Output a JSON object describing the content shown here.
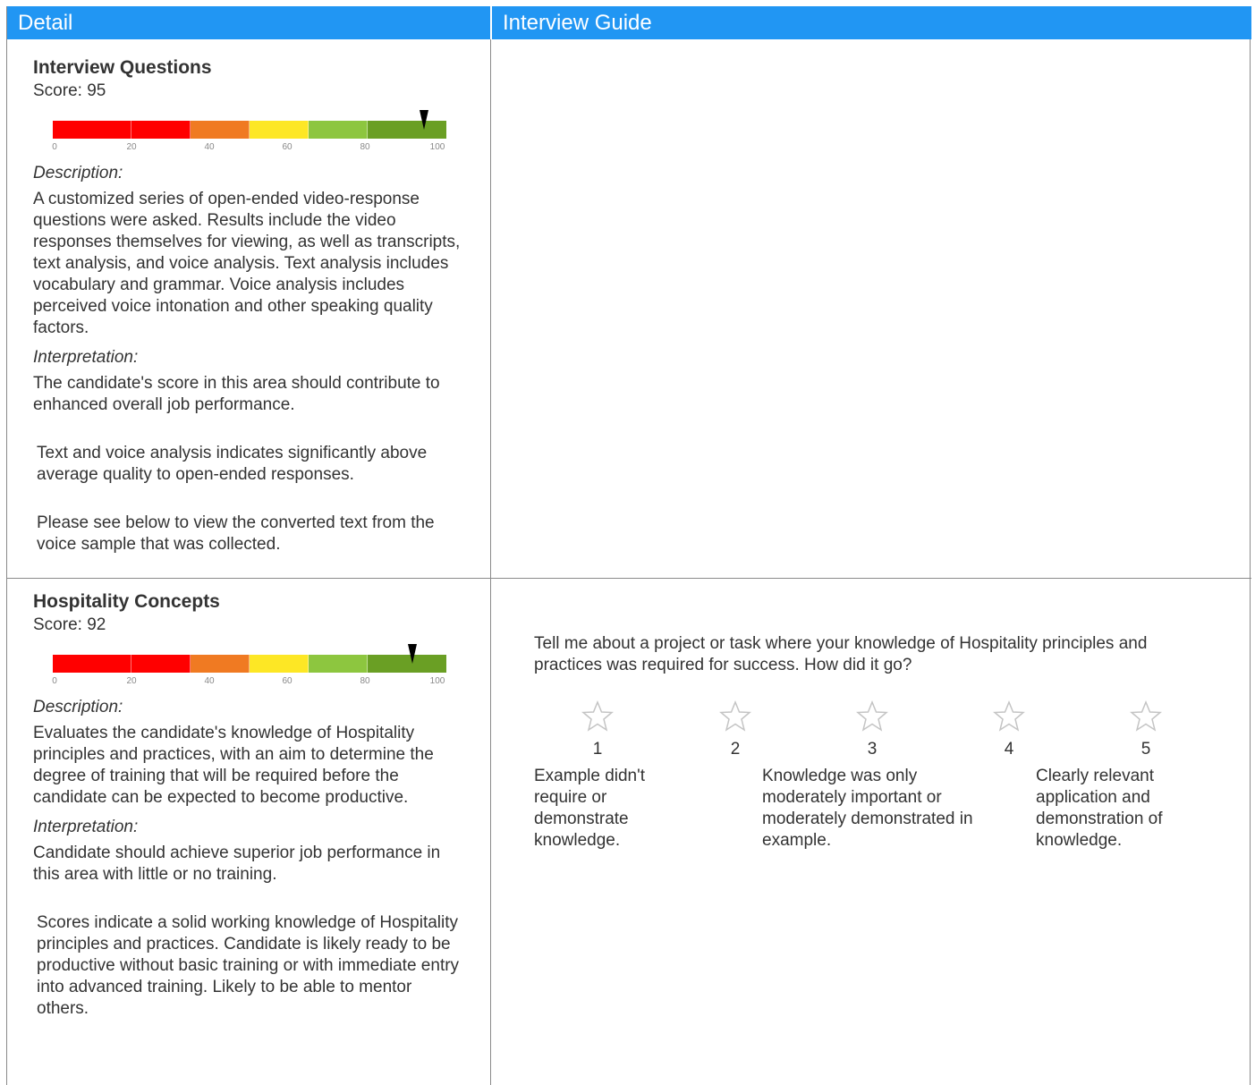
{
  "headers": {
    "detail": "Detail",
    "interview_guide": "Interview Guide"
  },
  "sections": [
    {
      "title": "Interview Questions",
      "score_text": "Score: 95",
      "score": 95,
      "gauge_ticks": [
        "0",
        "20",
        "40",
        "60",
        "80",
        "100"
      ],
      "description_label": "Description:",
      "description": "A customized series of open-ended video-response questions were asked. Results include the video responses themselves for viewing, as well as  transcripts, text analysis, and voice analysis. Text analysis includes vocabulary and grammar. Voice analysis includes perceived voice intonation and other speaking quality factors.",
      "interpretation_label": "Interpretation:",
      "interpretation": "The candidate's score in this area should contribute to enhanced overall job performance.",
      "notes": [
        "Text and voice analysis indicates significantly above average quality to open-ended responses.",
        "Please see below to view the converted text from the voice sample that was collected."
      ]
    },
    {
      "title": "Hospitality Concepts",
      "score_text": "Score: 92",
      "score": 92,
      "gauge_ticks": [
        "0",
        "20",
        "40",
        "60",
        "80",
        "100"
      ],
      "description_label": "Description:",
      "description": "Evaluates the candidate's knowledge of Hospitality principles and practices, with an aim to determine the degree of training that will be required before the candidate can be expected to become productive.",
      "interpretation_label": "Interpretation:",
      "interpretation": "Candidate should achieve superior job performance in this area with little or no training.",
      "notes": [
        "Scores indicate a solid working knowledge of Hospitality principles and practices. Candidate is likely ready to be productive without basic training or with immediate entry into advanced training. Likely to be able to mentor others."
      ]
    }
  ],
  "gauge_colors": [
    "#ff0000",
    "#ff0000",
    "#f07a22",
    "#fde725",
    "#8dc63f",
    "#6a9f24"
  ],
  "guide": {
    "question": "Tell me about a project or task where your knowledge of Hospitality principles and practices was required for success. How did it go?",
    "rating_numbers": [
      "1",
      "2",
      "3",
      "4",
      "5"
    ],
    "anchors": {
      "low": "Example didn't require or demonstrate knowledge.",
      "mid": "Knowledge was only moderately important or moderately demonstrated in example.",
      "high": "Clearly relevant application and demonstration of knowledge."
    }
  }
}
